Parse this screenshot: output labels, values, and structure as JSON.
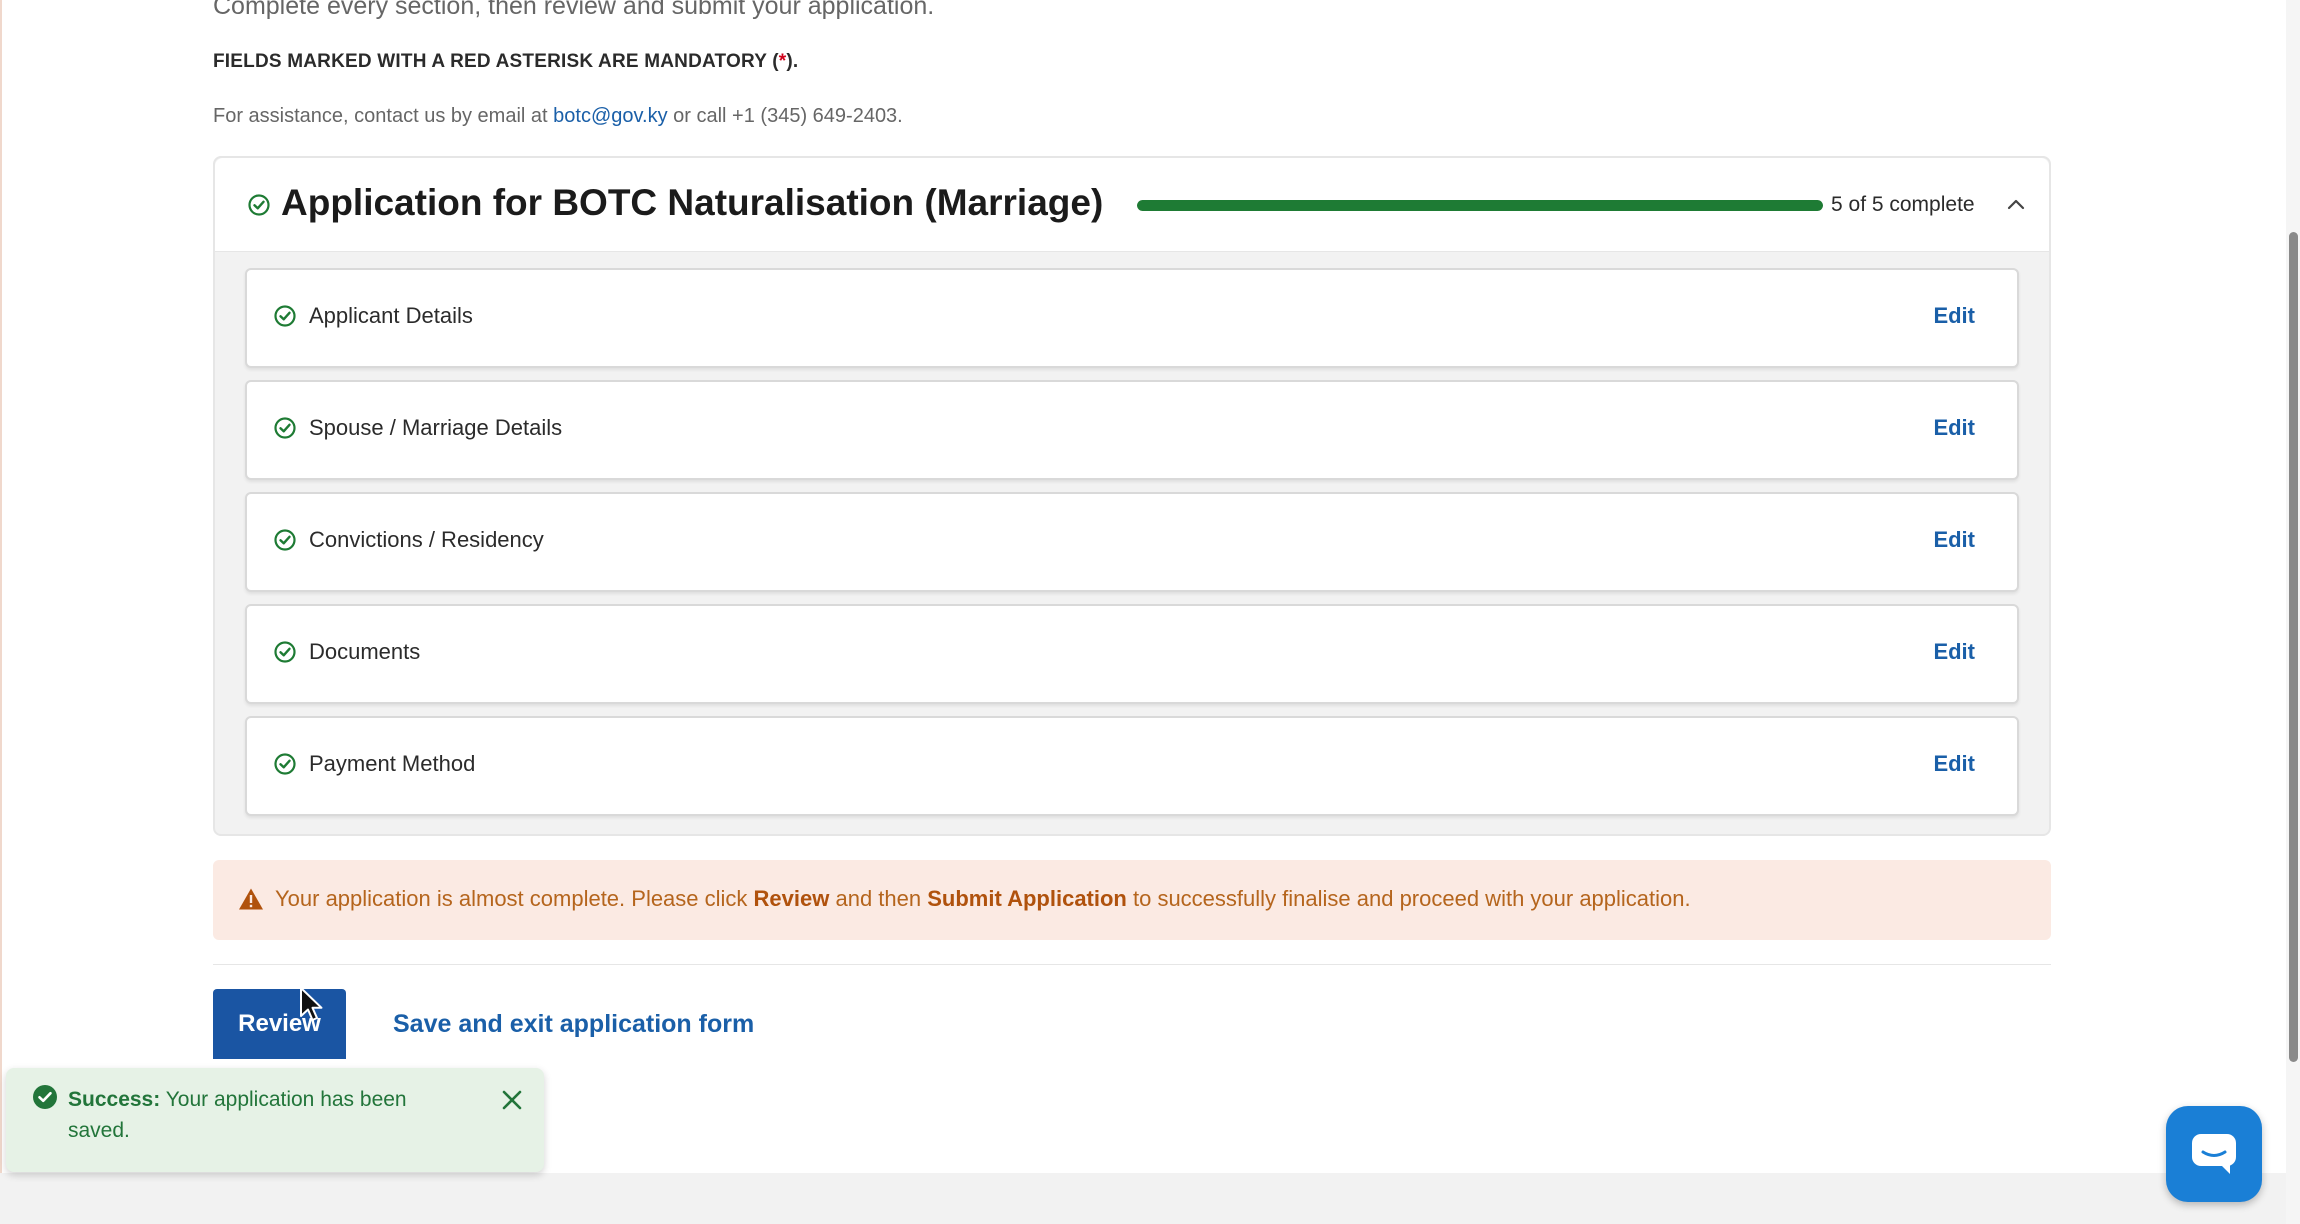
{
  "intro": {
    "instruction": "Complete every section, then review and submit your application.",
    "mandatory_prefix": "FIELDS MARKED WITH A RED ASTERISK ARE MANDATORY (",
    "mandatory_asterisk": "*",
    "mandatory_suffix": ").",
    "assist_prefix": "For assistance, contact us by email at ",
    "assist_email": "botc@gov.ky",
    "assist_suffix": " or call +1 (345) 649-2403."
  },
  "application": {
    "title": "Application for BOTC Naturalisation (Marriage)",
    "progress_text": "5 of 5 complete",
    "progress_fraction": 1.0,
    "progress_color": "#1e7b34",
    "collapse_icon": "chevron-up-icon",
    "sections": [
      {
        "label": "Applicant Details",
        "action": "Edit",
        "status_icon": "check-circle-icon"
      },
      {
        "label": "Spouse / Marriage Details",
        "action": "Edit",
        "status_icon": "check-circle-icon"
      },
      {
        "label": "Convictions / Residency",
        "action": "Edit",
        "status_icon": "check-circle-icon"
      },
      {
        "label": "Documents",
        "action": "Edit",
        "status_icon": "check-circle-icon"
      },
      {
        "label": "Payment Method",
        "action": "Edit",
        "status_icon": "check-circle-icon"
      }
    ]
  },
  "warning": {
    "icon": "warning-triangle-icon",
    "text_1": "Your application is almost complete. Please click ",
    "bold_1": "Review",
    "text_2": " and then ",
    "bold_2": "Submit Application",
    "text_3": " to successfully finalise and proceed with your application."
  },
  "actions": {
    "review_label": "Review",
    "save_exit_label": "Save and exit application form"
  },
  "toast": {
    "title": "Success:",
    "message": " Your application has been saved.",
    "icon": "check-circle-filled-icon",
    "close_icon": "close-icon"
  },
  "chat": {
    "icon": "chat-bubble-icon"
  },
  "colors": {
    "brand_blue": "#1a55a3",
    "link_blue": "#1a5fa8",
    "success_green": "#1e7b34",
    "warning_bg": "#fbeae3",
    "warning_text": "#b5651d"
  }
}
